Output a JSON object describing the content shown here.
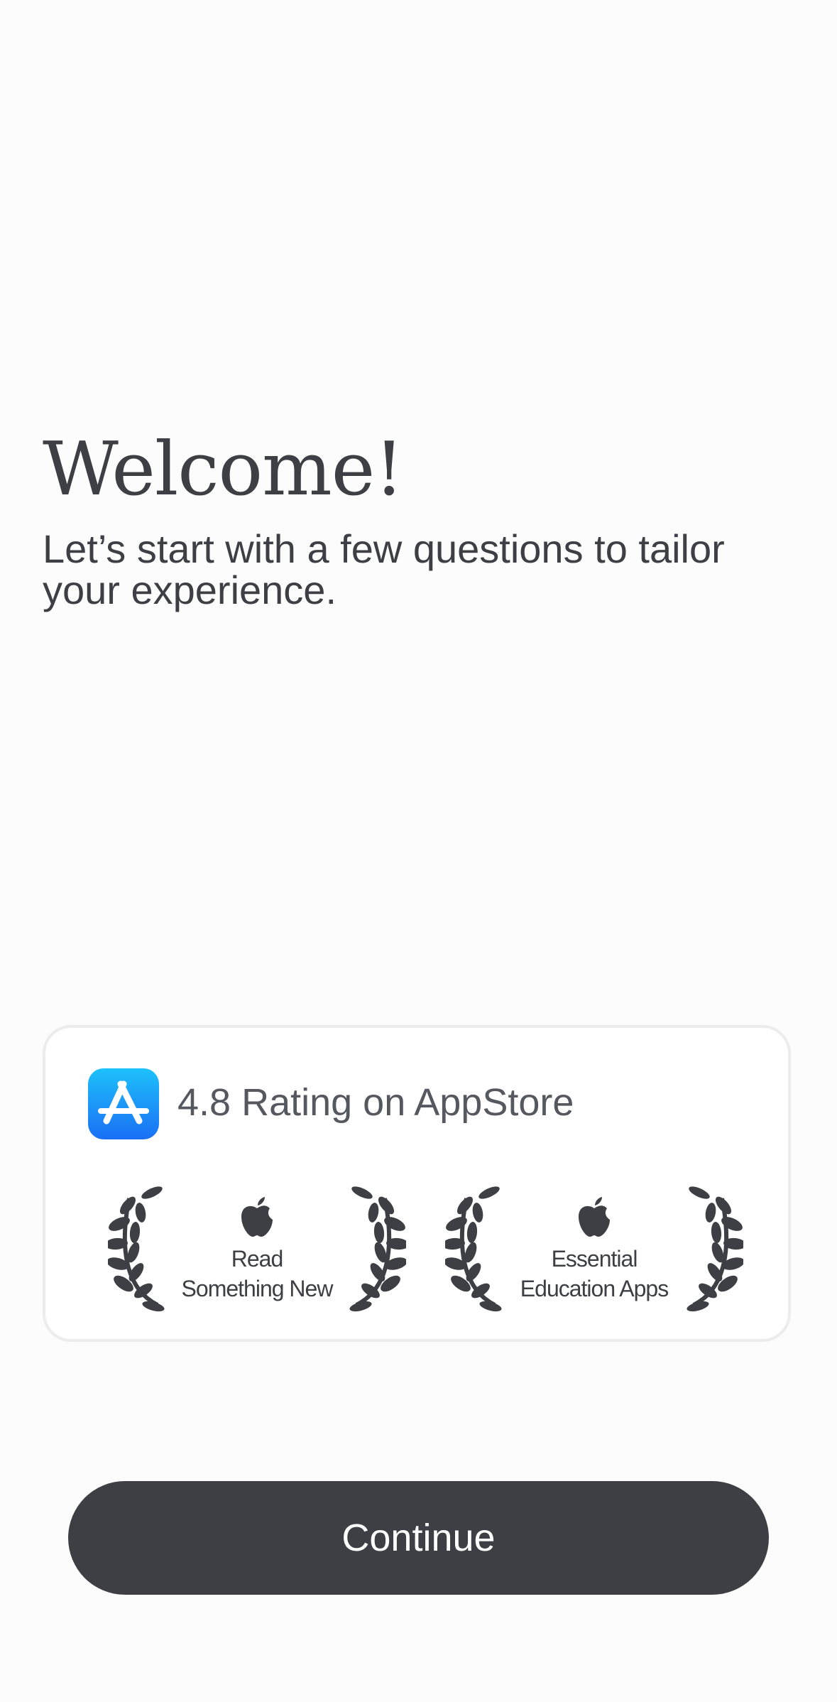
{
  "welcome": {
    "title": "Welcome!",
    "subtitle": "Let’s start with a few questions to tailor your experience."
  },
  "rating_card": {
    "icon": "app-store-icon",
    "rating_text": "4.8 Rating on AppStore",
    "awards": [
      {
        "icon": "apple-logo-icon",
        "line1": "Read",
        "line2": "Something New"
      },
      {
        "icon": "apple-logo-icon",
        "line1": "Essential",
        "line2": "Education Apps"
      }
    ]
  },
  "actions": {
    "continue_label": "Continue"
  },
  "colors": {
    "background": "#fcfcfc",
    "text": "#3e3f45",
    "button": "#3e3f45",
    "button_text": "#ffffff",
    "app_store_blue_top": "#1ec1fb",
    "app_store_blue_bottom": "#1a6ff5",
    "card_border": "#ececec"
  }
}
